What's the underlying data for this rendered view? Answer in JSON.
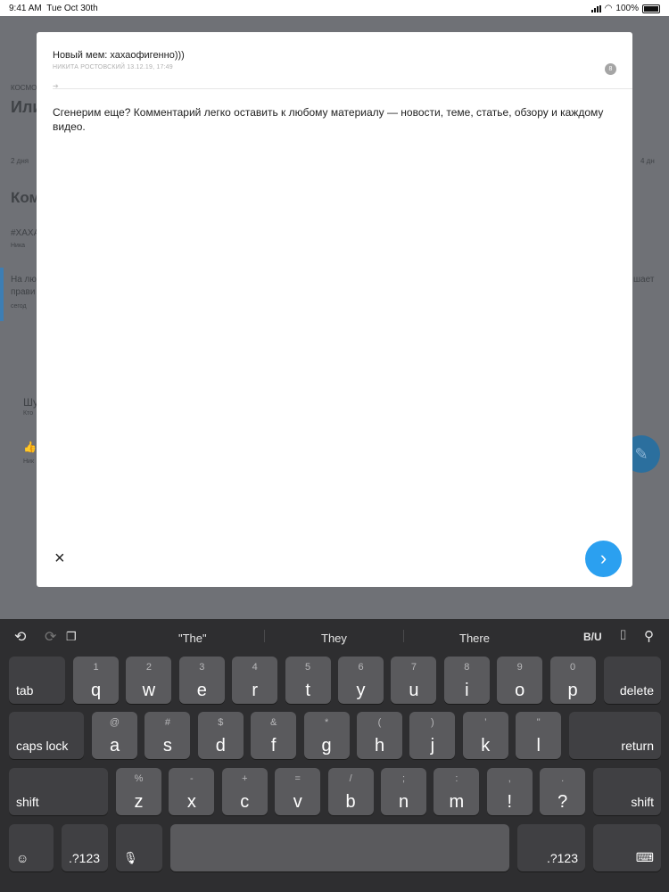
{
  "status": {
    "time": "9:41 AM",
    "date": "Tue Oct 30th",
    "battery": "100%"
  },
  "background": {
    "section_label": "КОСМО",
    "heading": "Или",
    "meta_left": "2 дня",
    "meta_right": "4 дн",
    "comments_heading": "Ком",
    "tag": "#ХАХА",
    "tag_meta": "Ника",
    "comment_text": "На лю",
    "comment_text2": "прави",
    "comment_right": "шает",
    "comment_meta": "сегод",
    "item1": "Шу",
    "item1_meta": "Кто",
    "item2": "👍",
    "item2_meta": "Ник"
  },
  "modal": {
    "title": "Новый мем: хахаофигенно)))",
    "author_meta": "НИКИТА РОСТОВСКИЙ 13.12.19, 17:49",
    "comment_count": "8",
    "input_text": "Сгенерим еще? Комментарий легко оставить к любому материалу — новости, теме, статье, обзору и каждому видео.",
    "close_icon": "×",
    "send_icon": "›"
  },
  "keyboard": {
    "suggestions": [
      "\"The\"",
      "They",
      "There"
    ],
    "format_label": "B/U",
    "row1": [
      {
        "k": "q",
        "s": "1"
      },
      {
        "k": "w",
        "s": "2"
      },
      {
        "k": "e",
        "s": "3"
      },
      {
        "k": "r",
        "s": "4"
      },
      {
        "k": "t",
        "s": "5"
      },
      {
        "k": "y",
        "s": "6"
      },
      {
        "k": "u",
        "s": "7"
      },
      {
        "k": "i",
        "s": "8"
      },
      {
        "k": "o",
        "s": "9"
      },
      {
        "k": "p",
        "s": "0"
      }
    ],
    "row2": [
      {
        "k": "a",
        "s": "@"
      },
      {
        "k": "s",
        "s": "#"
      },
      {
        "k": "d",
        "s": "$"
      },
      {
        "k": "f",
        "s": "&"
      },
      {
        "k": "g",
        "s": "*"
      },
      {
        "k": "h",
        "s": "("
      },
      {
        "k": "j",
        "s": ")"
      },
      {
        "k": "k",
        "s": "’"
      },
      {
        "k": "l",
        "s": "\""
      }
    ],
    "row3": [
      {
        "k": "z",
        "s": "%"
      },
      {
        "k": "x",
        "s": "-"
      },
      {
        "k": "c",
        "s": "+"
      },
      {
        "k": "v",
        "s": "="
      },
      {
        "k": "b",
        "s": "/"
      },
      {
        "k": "n",
        "s": ";"
      },
      {
        "k": "m",
        "s": ":"
      },
      {
        "k": "!",
        "s": ","
      },
      {
        "k": "?",
        "s": "."
      }
    ],
    "tab": "tab",
    "delete": "delete",
    "caps_lock": "caps lock",
    "return": "return",
    "shift": "shift",
    "numbers": ".?123"
  }
}
